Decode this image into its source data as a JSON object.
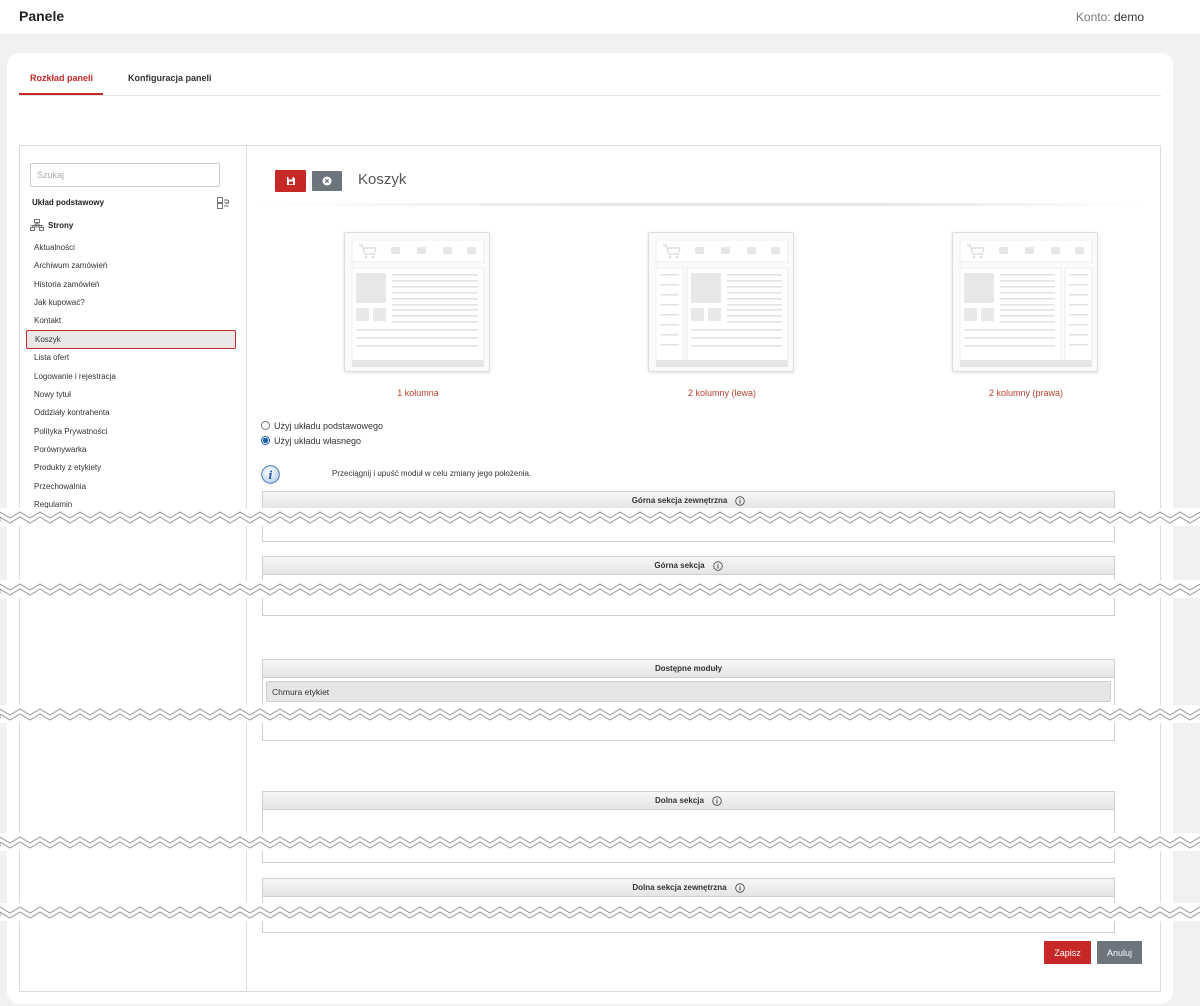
{
  "header": {
    "title": "Panele",
    "account_label": "Konto:",
    "account_value": "demo"
  },
  "tabs": [
    {
      "label": "Rozkład paneli",
      "active": true
    },
    {
      "label": "Konfiguracja paneli",
      "active": false
    }
  ],
  "sidebar": {
    "search_placeholder": "Szukaj",
    "base_layout_label": "Układ podstawowy",
    "group_label": "Strony",
    "pages": [
      "Aktualności",
      "Archiwum zamówień",
      "Historia zamówień",
      "Jak kupować?",
      "Kontakt",
      "Koszyk",
      "Lista ofert",
      "Logowanie i rejestracja",
      "Nowy tytuł",
      "Oddziały kontrahenta",
      "Polityka Prywatności",
      "Porównywarka",
      "Produkty z etykiety",
      "Przechowalnia",
      "Regulamin"
    ],
    "selected_page": "Koszyk"
  },
  "main": {
    "heading": "Koszyk",
    "layouts": [
      {
        "label": "1 kolumna",
        "type": "one"
      },
      {
        "label": "2 kolumny (lewa)",
        "type": "left"
      },
      {
        "label": "2 kolumny (prawa)",
        "type": "right"
      }
    ],
    "radio_options": [
      {
        "label": "Użyj układu podstawowego",
        "checked": false
      },
      {
        "label": "Użyj układu własnego",
        "checked": true
      }
    ],
    "drag_hint": "Przeciągnij i upuść moduł w celu zmiany jego położenia.",
    "sections": {
      "top_outer": "Górna sekcja zewnętrzna",
      "top": "Górna sekcja",
      "available": "Dostępne moduły",
      "bottom": "Dolna sekcja",
      "bottom_outer": "Dolna sekcja zewnętrzna"
    },
    "available_modules": [
      "Chmura etykiet"
    ],
    "save_label": "Zapisz",
    "cancel_label": "Anuluj"
  },
  "colors": {
    "accent": "#c62828",
    "secondary": "#6c757d",
    "link": "#b5432f"
  }
}
